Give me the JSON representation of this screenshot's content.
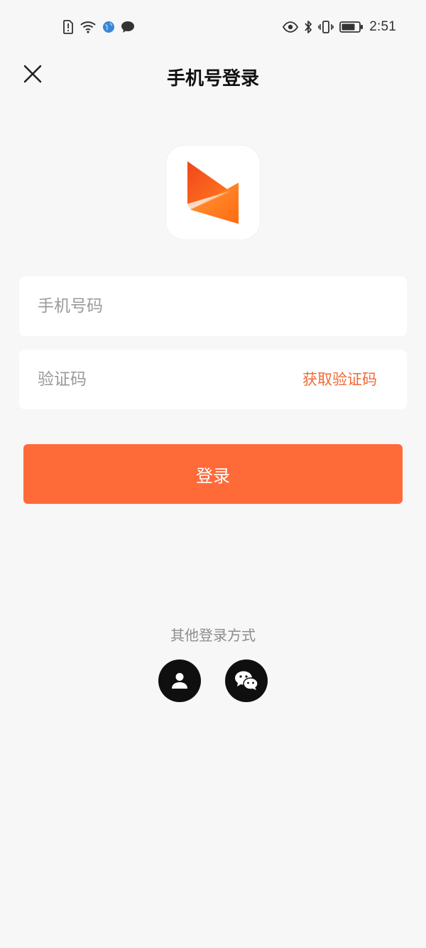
{
  "status_bar": {
    "time": "2:51",
    "left_icons": [
      "sim-alert-icon",
      "wifi-icon",
      "globe-icon",
      "chat-bubble-icon"
    ],
    "right_icons": [
      "eye-icon",
      "bluetooth-icon",
      "vibrate-icon",
      "battery-icon"
    ]
  },
  "header": {
    "title": "手机号登录",
    "close_icon": "close-icon"
  },
  "logo": {
    "icon": "app-logo-icon",
    "colors": [
      "#f35a1c",
      "#ff8a1f"
    ]
  },
  "form": {
    "phone": {
      "placeholder": "手机号码",
      "value": ""
    },
    "code": {
      "placeholder": "验证码",
      "value": "",
      "get_code_label": "获取验证码"
    },
    "login_label": "登录"
  },
  "alternatives": {
    "title": "其他登录方式",
    "options": [
      {
        "icon": "user-icon"
      },
      {
        "icon": "wechat-icon"
      }
    ]
  },
  "colors": {
    "accent": "#ff6a39",
    "accent_text": "#f06a35",
    "background": "#f7f7f7"
  }
}
